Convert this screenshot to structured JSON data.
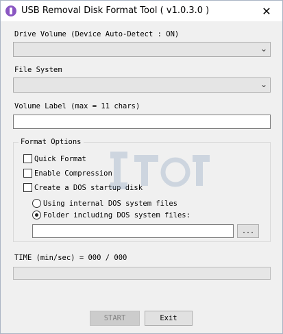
{
  "window": {
    "title": "USB Removal Disk Format Tool ( v1.0.3.0 )",
    "close_glyph": "✕"
  },
  "drive": {
    "label": "Drive Volume  (Device Auto-Detect : ON)",
    "value": ""
  },
  "filesystem": {
    "label": "File System",
    "value": ""
  },
  "volume": {
    "label": "Volume Label (max = 11 chars)",
    "value": ""
  },
  "format_options": {
    "title": "Format Options",
    "quick_format": "Quick Format",
    "enable_compression": "Enable Compression",
    "create_dos_disk": "Create a DOS startup disk",
    "radio_internal": "Using internal DOS system files",
    "radio_folder": "Folder including DOS system files:",
    "folder_path": "",
    "browse_label": "..."
  },
  "time": {
    "label": "TIME (min/sec) = 000 / 000"
  },
  "progress": {
    "value": 0
  },
  "buttons": {
    "start": "START",
    "exit": "Exit"
  },
  "icons": {
    "chevron": "⌄"
  },
  "colors": {
    "window_bg": "#f0f0f0",
    "app_icon": "#8a56c2",
    "disabled_text": "#838383"
  }
}
